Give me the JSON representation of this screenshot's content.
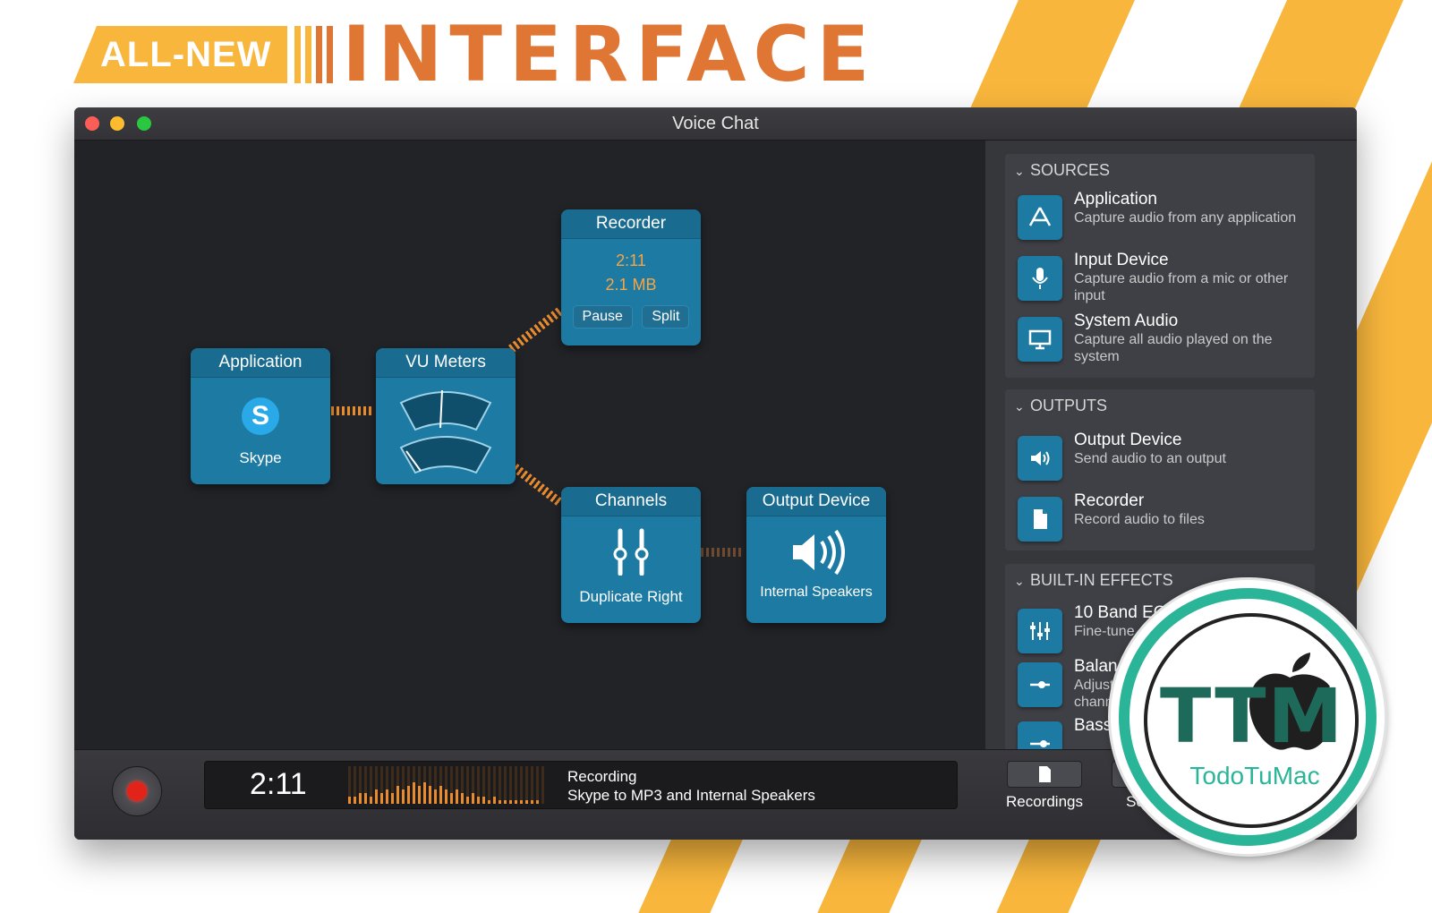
{
  "banner": {
    "badge": "ALL-NEW",
    "headline": "INTERFACE"
  },
  "window": {
    "title": "Voice Chat"
  },
  "nodes": {
    "application": {
      "title": "Application",
      "label": "Skype"
    },
    "vu": {
      "title": "VU Meters"
    },
    "recorder": {
      "title": "Recorder",
      "time": "2:11",
      "size": "2.1 MB",
      "pause": "Pause",
      "split": "Split"
    },
    "channels": {
      "title": "Channels",
      "label": "Duplicate Right"
    },
    "output": {
      "title": "Output Device",
      "label": "Internal Speakers"
    }
  },
  "sidebar": {
    "sources": {
      "header": "SOURCES",
      "items": [
        {
          "title": "Application",
          "desc": "Capture audio from any application"
        },
        {
          "title": "Input Device",
          "desc": "Capture audio from a mic or other input"
        },
        {
          "title": "System Audio",
          "desc": "Capture all audio played on the system"
        }
      ]
    },
    "outputs": {
      "header": "OUTPUTS",
      "items": [
        {
          "title": "Output Device",
          "desc": "Send audio to an output"
        },
        {
          "title": "Recorder",
          "desc": "Record audio to files"
        }
      ]
    },
    "effects": {
      "header": "BUILT-IN EFFECTS",
      "items": [
        {
          "title": "10 Band EQ",
          "desc": "Fine-tune s"
        },
        {
          "title": "Balanc",
          "desc": "Adjust t channe"
        },
        {
          "title": "Bass &",
          "desc": ""
        }
      ]
    }
  },
  "bottom": {
    "time": "2:11",
    "status_title": "Recording",
    "status_detail": "Skype to MP3 and Internal Speakers",
    "recordings_label": "Recordings",
    "second_label": "Sc"
  },
  "watermark": {
    "mark": "TTM",
    "name": "TodoTuMac"
  },
  "colors": {
    "accent": "#f8b63c",
    "headline": "#e07634",
    "node": "#1c7aa3",
    "record": "#e2231a",
    "logo": "#2bb598"
  }
}
